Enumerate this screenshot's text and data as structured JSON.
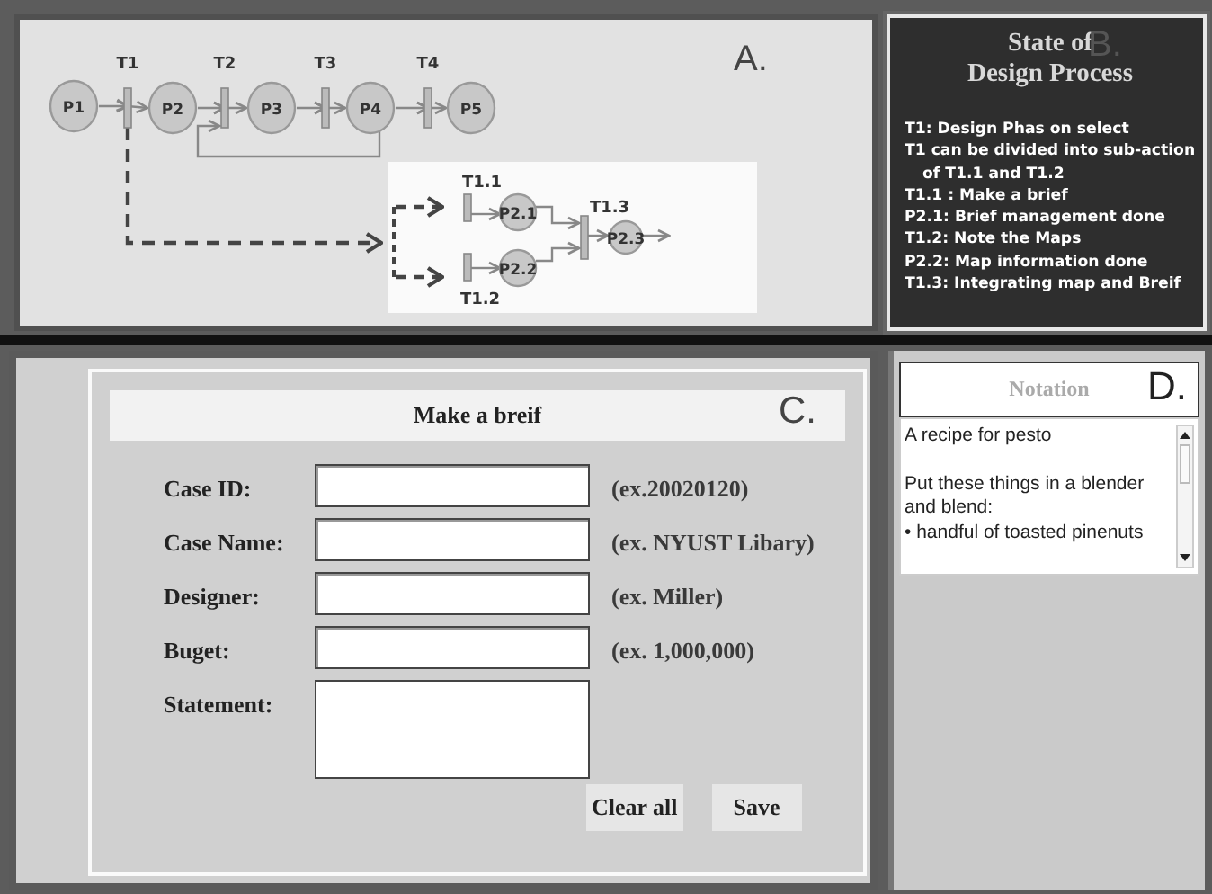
{
  "process_panel": {
    "label": "A.",
    "places": [
      {
        "label": "P1"
      },
      {
        "label": "P2"
      },
      {
        "label": "P3"
      },
      {
        "label": "P4"
      },
      {
        "label": "P5"
      }
    ],
    "transitions": [
      {
        "label": "T1"
      },
      {
        "label": "T2"
      },
      {
        "label": "T3"
      },
      {
        "label": "T4"
      }
    ],
    "sub_places": [
      {
        "label": "P2.1"
      },
      {
        "label": "P2.2"
      },
      {
        "label": "P2.3"
      }
    ],
    "sub_transitions": [
      {
        "label": "T1.1"
      },
      {
        "label": "T1.2"
      },
      {
        "label": "T1.3"
      }
    ]
  },
  "state_panel": {
    "title_lines": [
      "State of",
      "Design Process"
    ],
    "label": "B.",
    "lines": [
      "T1: Design Phas on select",
      "T1 can be divided into  sub-action of T1.1 and T1.2",
      "T1.1 : Make a brief",
      "P2.1: Brief management done",
      "T1.2:  Note the Maps",
      "P2.2:  Map information  done",
      "T1.3: Integrating map and Breif"
    ]
  },
  "form_panel": {
    "title": "Make a breif",
    "label": "C.",
    "fields": [
      {
        "label": "Case ID:",
        "kind": "text",
        "hint": "(ex.20020120)"
      },
      {
        "label": "Case Name:",
        "kind": "text",
        "hint": "(ex. NYUST Libary)"
      },
      {
        "label": "Designer:",
        "kind": "text",
        "hint": "(ex.  Miller)"
      },
      {
        "label": "Buget:",
        "kind": "text",
        "hint": "(ex.  1,000,000)"
      },
      {
        "label": "Statement:",
        "kind": "textarea"
      }
    ],
    "buttons": [
      "Clear all",
      "Save"
    ]
  },
  "notation_panel": {
    "title": "Notation",
    "label": "D.",
    "paragraphs": [
      "A recipe for pesto",
      "Put these things in a blender and blend:",
      "• handful of toasted pinenuts"
    ]
  }
}
